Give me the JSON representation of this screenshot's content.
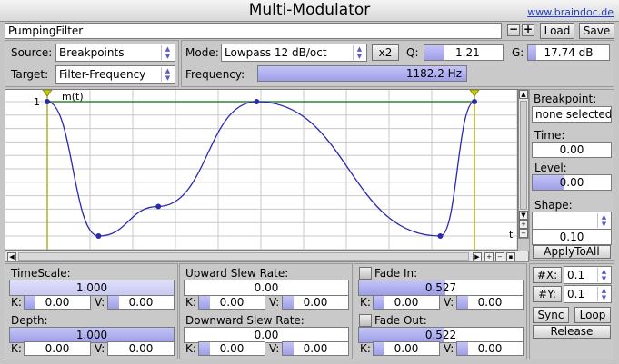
{
  "window": {
    "title": "Multi-Modulator",
    "url": "www.braindoc.de"
  },
  "preset": {
    "name": "PumpingFilter",
    "minus": "−",
    "plus": "+",
    "load": "Load",
    "save": "Save"
  },
  "routing": {
    "source_label": "Source:",
    "source_value": "Breakpoints",
    "target_label": "Target:",
    "target_value": "Filter-Frequency"
  },
  "filter": {
    "mode_label": "Mode:",
    "mode_value": "Lowpass 12 dB/oct",
    "x2_label": "x2",
    "q_label": "Q:",
    "q_value": "1.21",
    "q_fraction": 0.25,
    "g_label": "G:",
    "g_value": "17.74 dB",
    "g_fraction": 0.1,
    "freq_label": "Frequency:",
    "freq_value": "1182.2 Hz",
    "freq_fraction": 1.0
  },
  "editor": {
    "curve_label": "m(t)",
    "y_tick": "1",
    "x_axis_label": "t",
    "grid_color": "#c8c8c8",
    "curve_color": "#2a2ab0",
    "level_line_color": "#2a8a2a",
    "loop_marker_color": "#b0b020",
    "breakpoints": [
      {
        "t": 0.0,
        "level": 1.0
      },
      {
        "t": 0.12,
        "level": 0.0
      },
      {
        "t": 0.26,
        "level": 0.22
      },
      {
        "t": 0.49,
        "level": 1.0
      },
      {
        "t": 0.92,
        "level": 0.0
      },
      {
        "t": 1.0,
        "level": 1.0
      }
    ]
  },
  "breakpoint_panel": {
    "heading": "Breakpoint:",
    "selection": "none selected",
    "time_label": "Time:",
    "time_value": "0.00",
    "level_label": "Level:",
    "level_value": "0.00",
    "shape_label": "Shape:",
    "shape_value": "",
    "shape_amount": "0.10",
    "apply_label": "ApplyToAll"
  },
  "timescale": {
    "label": "TimeScale:",
    "value": "1.000",
    "k_label": "K:",
    "k_value": "0.00",
    "v_label": "V:",
    "v_value": "0.00"
  },
  "depth": {
    "label": "Depth:",
    "value": "1.000",
    "k_label": "K:",
    "k_value": "0.00",
    "v_label": "V:",
    "v_value": "0.00"
  },
  "upward_slew": {
    "label": "Upward Slew Rate:",
    "value": "0.00",
    "k_label": "K:",
    "k_value": "0.00",
    "v_label": "V:",
    "v_value": "0.00"
  },
  "downward_slew": {
    "label": "Downward Slew Rate:",
    "value": "0.00",
    "k_label": "K:",
    "k_value": "0.00",
    "v_label": "V:",
    "v_value": "0.00"
  },
  "fade_in": {
    "label": "Fade In:",
    "value": "0.527",
    "fraction": 0.53,
    "k_label": "K:",
    "k_value": "0.00",
    "v_label": "V:",
    "v_value": "0.00"
  },
  "fade_out": {
    "label": "Fade Out:",
    "value": "0.522",
    "fraction": 0.52,
    "k_label": "K:",
    "k_value": "0.00",
    "v_label": "V:",
    "v_value": "0.00"
  },
  "grid_controls": {
    "x_label": "#X:",
    "x_value": "0.1",
    "y_label": "#Y:",
    "y_value": "0.1",
    "sync_label": "Sync",
    "loop_label": "Loop",
    "release_label": "Release"
  }
}
